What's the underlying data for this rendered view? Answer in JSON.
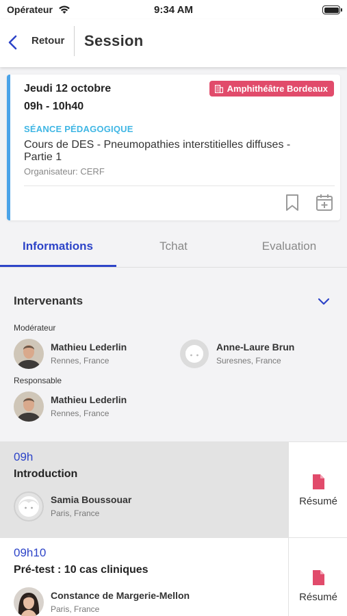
{
  "status_bar": {
    "carrier": "Opérateur",
    "time": "9:34 AM"
  },
  "navbar": {
    "back_label": "Retour",
    "title": "Session"
  },
  "session": {
    "date": "Jeudi 12 octobre",
    "hours": "09h - 10h40",
    "room": "Amphithéâtre Bordeaux",
    "type": "SÉANCE PÉDAGOGIQUE",
    "title": "Cours de DES - Pneumopathies interstitielles diffuses -  Partie 1",
    "organizer": "Organisateur: CERF",
    "accent_color": "#4aa3e8",
    "room_color": "#e14b6b"
  },
  "tabs": [
    {
      "label": "Informations",
      "active": true
    },
    {
      "label": "Tchat",
      "active": false
    },
    {
      "label": "Evaluation",
      "active": false
    }
  ],
  "intervenants": {
    "heading": "Intervenants",
    "moderateur_label": "Modérateur",
    "responsable_label": "Responsable",
    "moderateurs": [
      {
        "name": "Mathieu Lederlin",
        "location": "Rennes, France",
        "avatar": "photo"
      },
      {
        "name": "Anne-Laure Brun",
        "location": "Suresnes, France",
        "avatar": "placeholder"
      }
    ],
    "responsables": [
      {
        "name": "Mathieu Lederlin",
        "location": "Rennes, France",
        "avatar": "photo"
      }
    ]
  },
  "talks": [
    {
      "time": "09h",
      "title": "Introduction",
      "speaker": "Samia Boussouar",
      "location": "Paris, France",
      "resume_label": "Résumé",
      "highlighted": true
    },
    {
      "time": "09h10",
      "title": "Pré-test :  10 cas cliniques",
      "speaker": "Constance de Margerie-Mellon",
      "location": "Paris, France",
      "resume_label": "Résumé",
      "highlighted": false
    }
  ],
  "colors": {
    "primary": "#2d44c8",
    "accent_pink": "#e14b6b"
  }
}
